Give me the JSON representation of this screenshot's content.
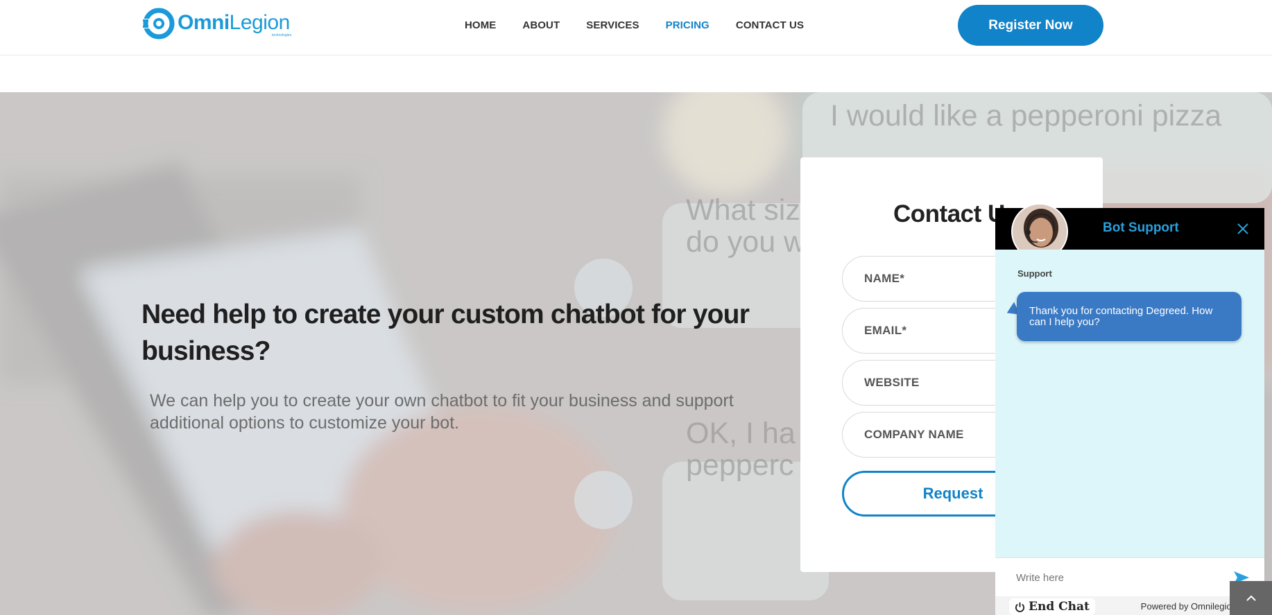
{
  "header": {
    "logo": {
      "bold": "Omni",
      "light": "Legion",
      "tagline": "technologies"
    },
    "nav": [
      {
        "label": "HOME",
        "active": false
      },
      {
        "label": "ABOUT",
        "active": false
      },
      {
        "label": "SERVICES",
        "active": false
      },
      {
        "label": "PRICING",
        "active": true
      },
      {
        "label": "CONTACT US",
        "active": false
      }
    ],
    "register_label": "Register Now"
  },
  "hero": {
    "heading": "Need help to create your custom chatbot for your business?",
    "subtext": "We can help you to create your own chatbot to fit your business and support additional options to customize your bot.",
    "background_bubbles": [
      "I would like a pepperoni pizza",
      "What siz",
      "do you w",
      "OK, I ha",
      "pepperc"
    ]
  },
  "contact_form": {
    "title": "Contact U",
    "fields": [
      {
        "placeholder": "NAME*"
      },
      {
        "placeholder": "EMAIL*"
      },
      {
        "placeholder": "WEBSITE"
      },
      {
        "placeholder": "COMPANY NAME"
      }
    ],
    "submit_label": "Request"
  },
  "chat_widget": {
    "title": "Bot Support",
    "sender": "Support",
    "message": "Thank you for contacting Degreed. How can I help you?",
    "input_placeholder": "Write here",
    "end_chat_label": "End Chat",
    "powered_by": "Powered by Omnilegion.com"
  },
  "colors": {
    "brand_blue": "#1183c8",
    "chat_header": "#000000",
    "chat_body": "#dcf6f9",
    "message_bubble": "#3a7ac5"
  }
}
